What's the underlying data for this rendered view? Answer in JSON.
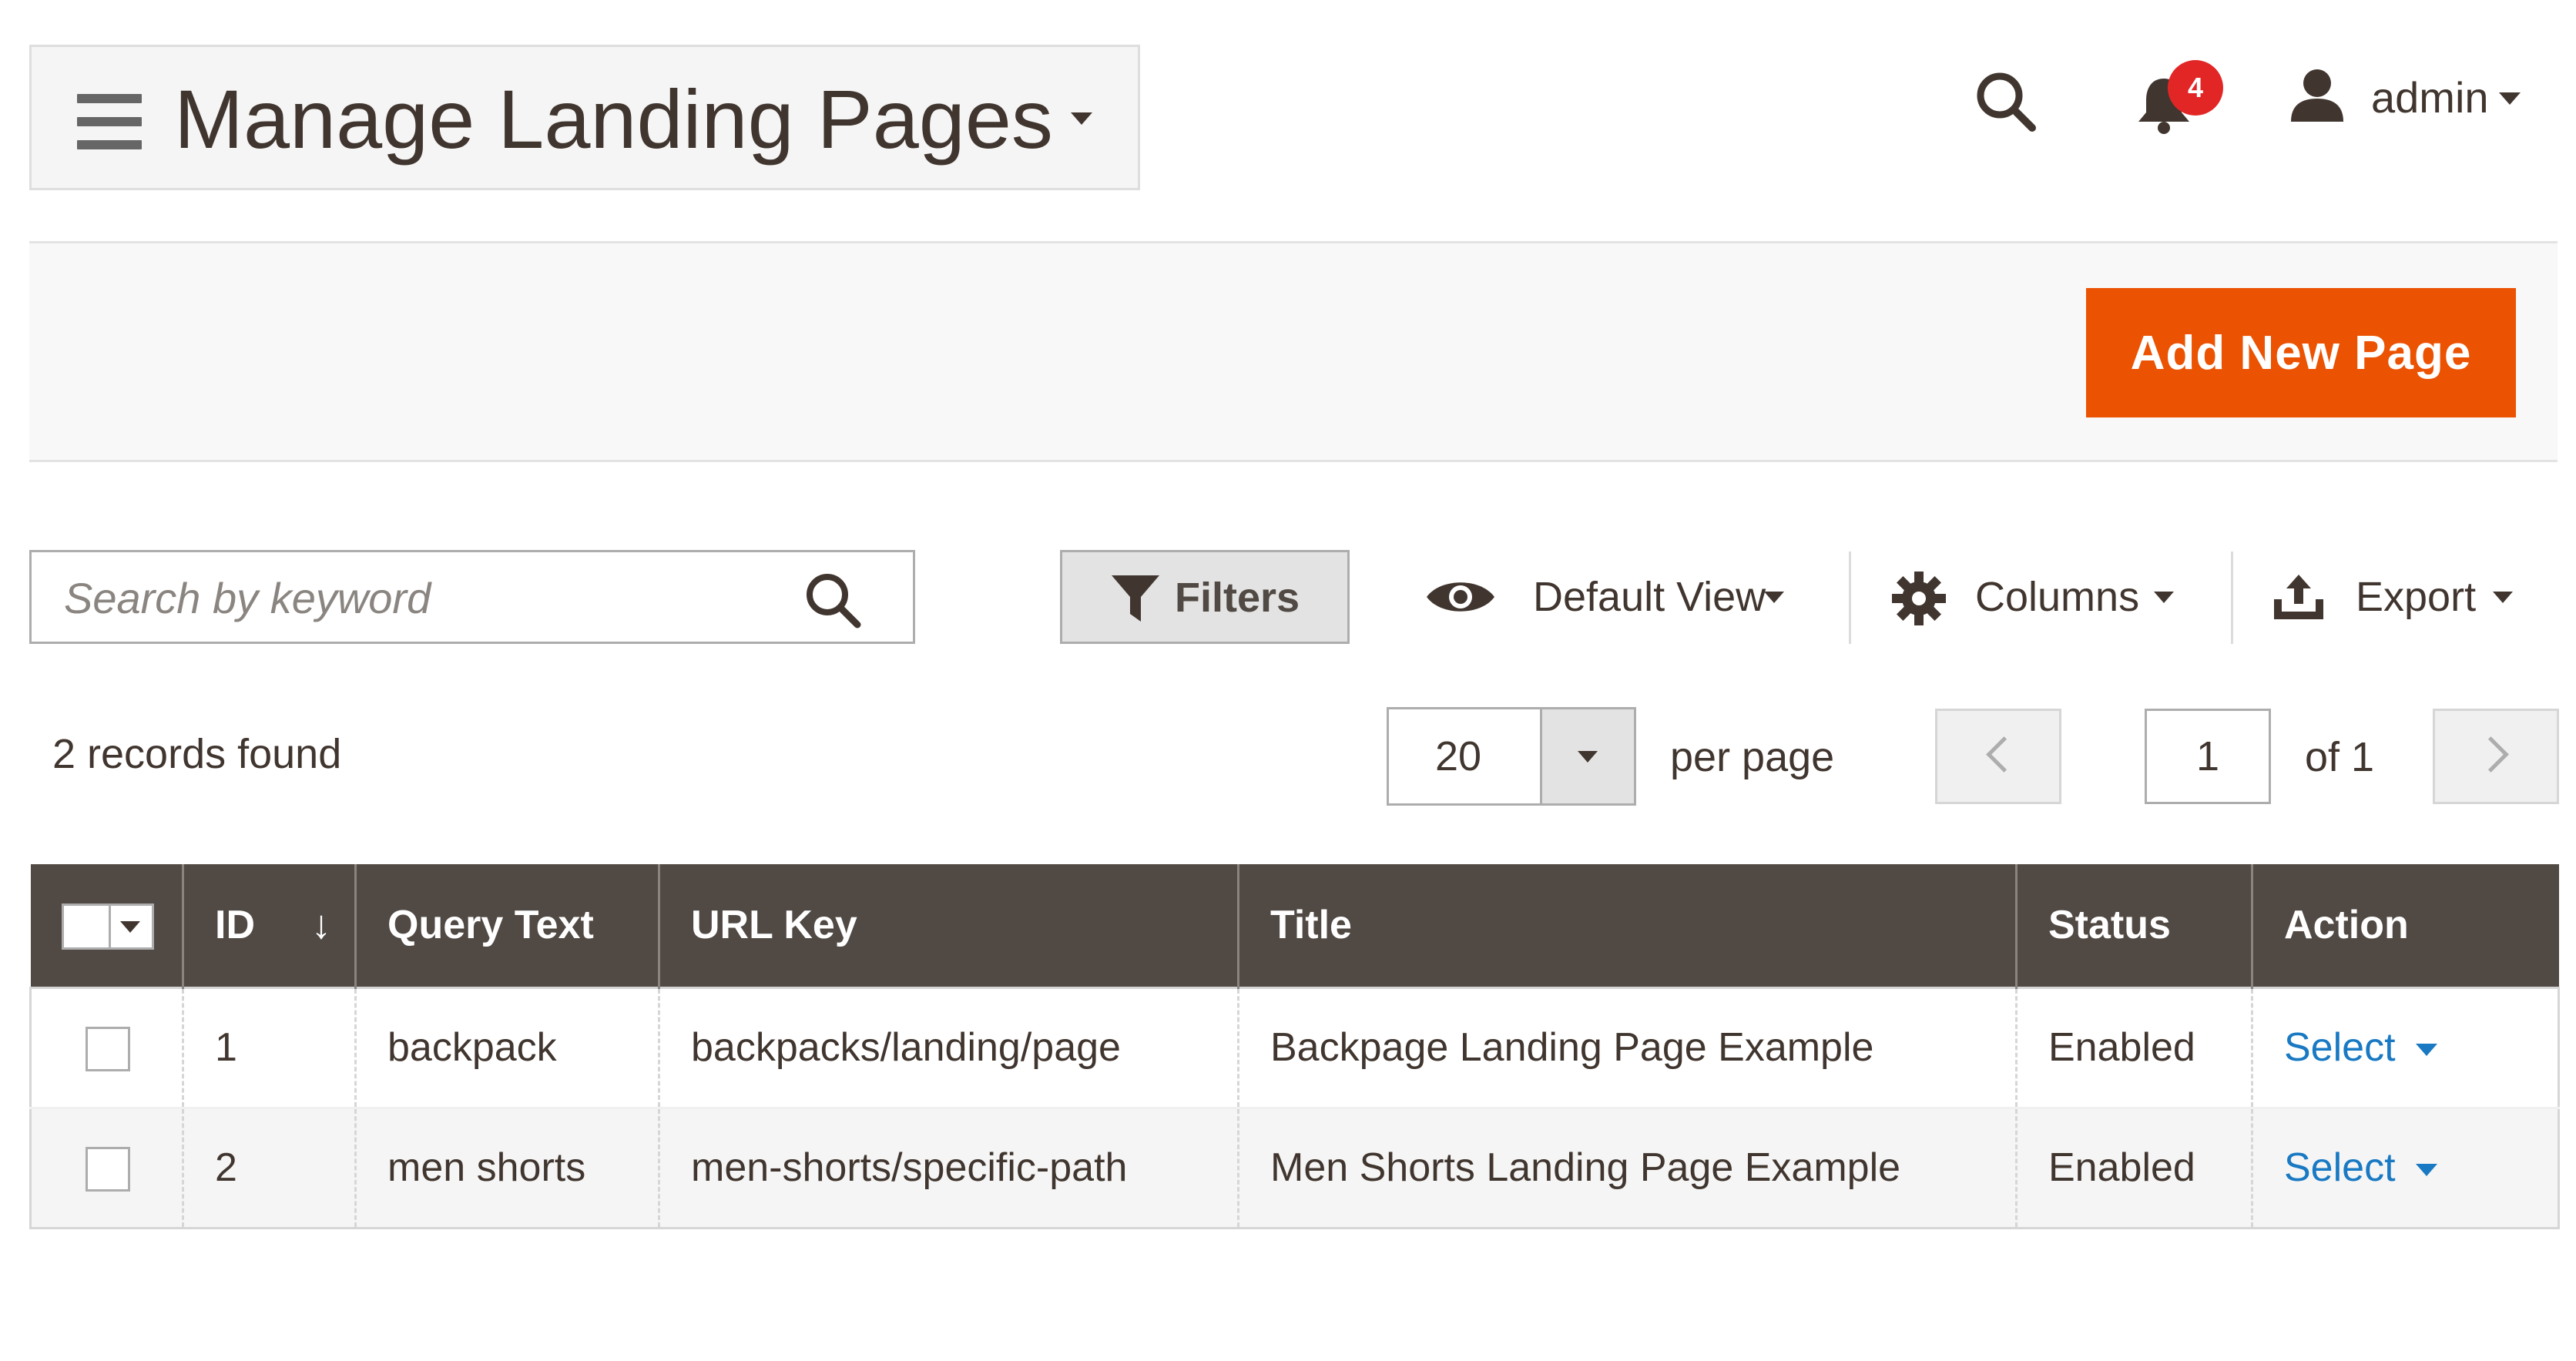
{
  "header": {
    "title": "Manage Landing Pages",
    "notifications_count": "4",
    "user_name": "admin"
  },
  "actions": {
    "add_new_label": "Add New Page"
  },
  "toolbar": {
    "search_placeholder": "Search by keyword",
    "filters_label": "Filters",
    "view_label": "Default View",
    "columns_label": "Columns",
    "export_label": "Export"
  },
  "pagination": {
    "records_found": "2 records found",
    "per_page_value": "20",
    "per_page_label": "per page",
    "current_page": "1",
    "of_label": "of 1"
  },
  "grid": {
    "columns": [
      "ID",
      "Query Text",
      "URL Key",
      "Title",
      "Status",
      "Action"
    ],
    "sort_indicator": "↓",
    "rows": [
      {
        "id": "1",
        "query": "backpack",
        "url_key": "backpacks/landing/page",
        "title": "Backpage Landing Page Example",
        "status": "Enabled",
        "action": "Select"
      },
      {
        "id": "2",
        "query": "men shorts",
        "url_key": "men-shorts/specific-path",
        "title": "Men Shorts Landing Page Example",
        "status": "Enabled",
        "action": "Select"
      }
    ]
  },
  "colors": {
    "accent": "#eb5202",
    "header_bg": "#514943",
    "link": "#1979c3",
    "badge": "#e22626"
  },
  "icons": [
    "hamburger-icon",
    "caret-down-icon",
    "search-icon",
    "bell-icon",
    "user-icon",
    "filter-icon",
    "eye-icon",
    "gear-icon",
    "export-icon",
    "chevron-left-icon",
    "chevron-right-icon"
  ]
}
